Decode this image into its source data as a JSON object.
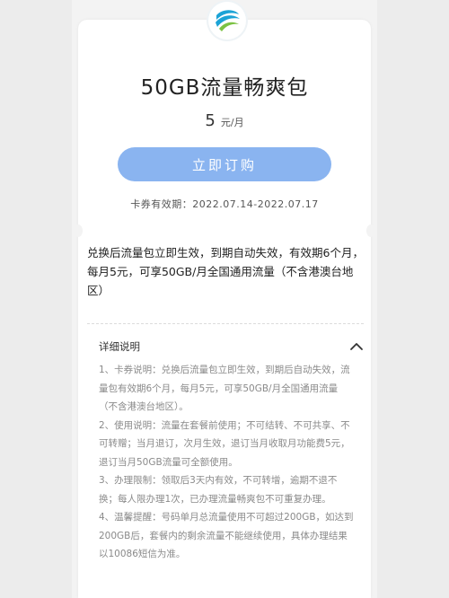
{
  "logo": {
    "icon": "china-mobile-logo-icon",
    "color": "#1ba3d6"
  },
  "package": {
    "title": "50GB流量畅爽包",
    "price": "5",
    "price_unit": "元/月",
    "subscribe_label": "立即订购",
    "validity": "卡券有效期：2022.07.14-2022.07.17"
  },
  "summary": "兑换后流量包立即生效，到期自动失效，有效期6个月，每月5元，可享50GB/月全国通用流量（不含港澳台地区）",
  "details": {
    "heading": "详细说明",
    "toggle_icon": "chevron-up-icon",
    "items": [
      "1、卡券说明：兑换后流量包立即生效，到期后自动失效，流量包有效期6个月，每月5元，可享50GB/月全国通用流量（不含港澳台地区）。",
      "2、使用说明：流量在套餐前使用；不可结转、不可共享、不可转赠；当月退订，次月生效，退订当月收取月功能费5元，退订当月50GB流量可全额使用。",
      "3、办理限制：领取后3天内有效，不可转增，逾期不退不换；每人限办理1次，已办理流量畅爽包不可重复办理。",
      "4、温馨提醒：号码单月总流量使用不可超过200GB，如达到200GB后，套餐内的剩余流量不能继续使用，具体办理结果以10086短信为准。"
    ]
  },
  "colors": {
    "button": "#8ab4f0",
    "accent": "#1ba3d6"
  }
}
